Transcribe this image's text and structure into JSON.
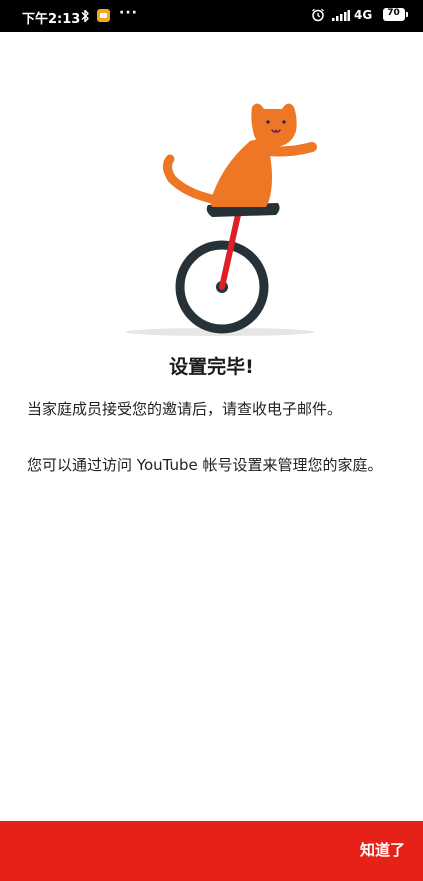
{
  "status_bar": {
    "time": "下午2:13",
    "more": "···",
    "network": "4G",
    "battery": "70",
    "icons": [
      "bluetooth-icon",
      "message-icon",
      "more-icon",
      "alarm-icon",
      "signal-icon",
      "battery-icon"
    ]
  },
  "dialog": {
    "illustration": "cat-on-unicycle",
    "title": "设置完毕!",
    "body_line_1": "当家庭成员接受您的邀请后，请查收电子邮件。",
    "body_line_2": "您可以通过访问 YouTube 帐号设置来管理您的家庭。"
  },
  "actions": {
    "got_it_label": "知道了"
  },
  "colors": {
    "accent": "#e62117",
    "cat": "#ee7725",
    "wheel": "#263238",
    "seat_post": "#e01e26",
    "background": "#ffffff"
  }
}
